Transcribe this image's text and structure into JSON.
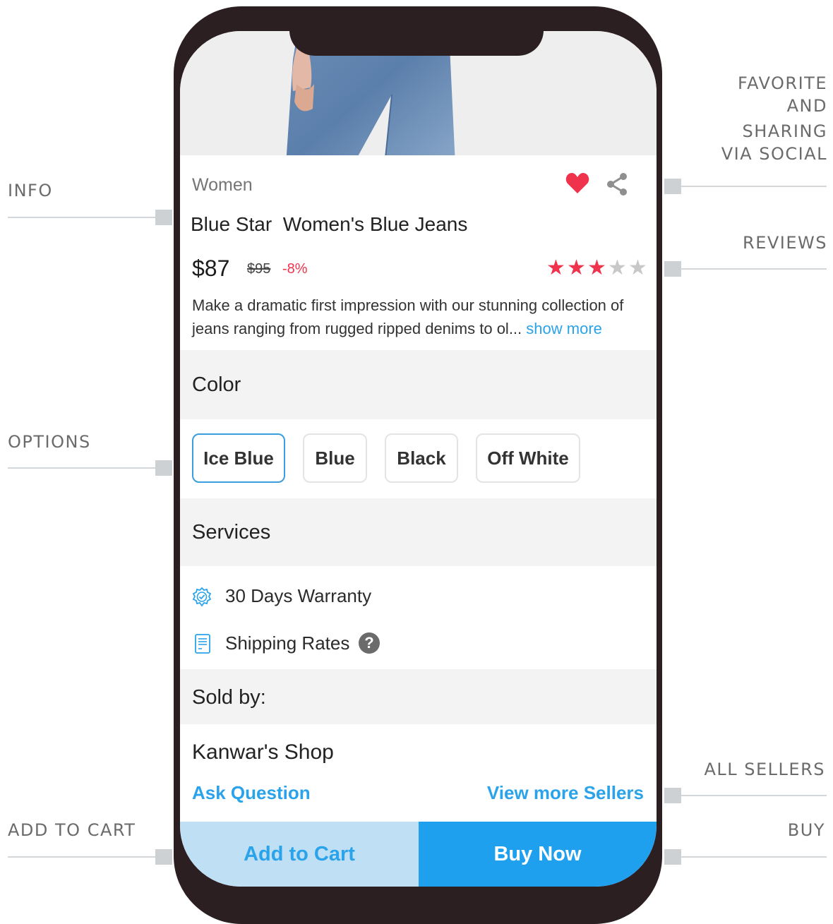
{
  "callouts": {
    "info": "INFO",
    "favorite": [
      "FAVORITE",
      "AND",
      "SHARING",
      "VIA SOCIAL"
    ],
    "reviews": "REVIEWS",
    "options": "OPTIONS",
    "all_sellers": "ALL SELLERS",
    "add_to_cart": "ADD TO CART",
    "buy": "BUY"
  },
  "product": {
    "category": "Women",
    "title": "Blue Star  Women's Blue Jeans",
    "price": "$87",
    "old_price": "$95",
    "discount": "-8%",
    "rating": 3,
    "rating_max": 5,
    "description": "Make a dramatic first impression with our stunning collection of jeans ranging from rugged ripped denims to ol...",
    "show_more": "show more",
    "favorited": true
  },
  "options": {
    "label": "Color",
    "colors": [
      "Ice Blue",
      "Blue",
      "Black",
      "Off White"
    ],
    "selected": "Ice Blue"
  },
  "services": {
    "label": "Services",
    "items": [
      {
        "text": "30 Days Warranty",
        "icon": "warranty-badge-icon"
      },
      {
        "text": "Shipping Rates",
        "icon": "receipt-icon",
        "help_icon": "question-icon"
      }
    ]
  },
  "seller": {
    "label": "Sold by:",
    "shop": "Kanwar's Shop",
    "ask": "Ask Question",
    "view_more": "View more Sellers"
  },
  "actions": {
    "add_to_cart": "Add to Cart",
    "buy_now": "Buy Now"
  },
  "colors": {
    "accent": "#2aa3ea",
    "buy": "#1fa0ef",
    "cart_bg": "#bfdff4",
    "sale": "#f0334d",
    "star_on": "#f0334d",
    "star_off": "#c8c8c8",
    "heart": "#f0334d"
  }
}
